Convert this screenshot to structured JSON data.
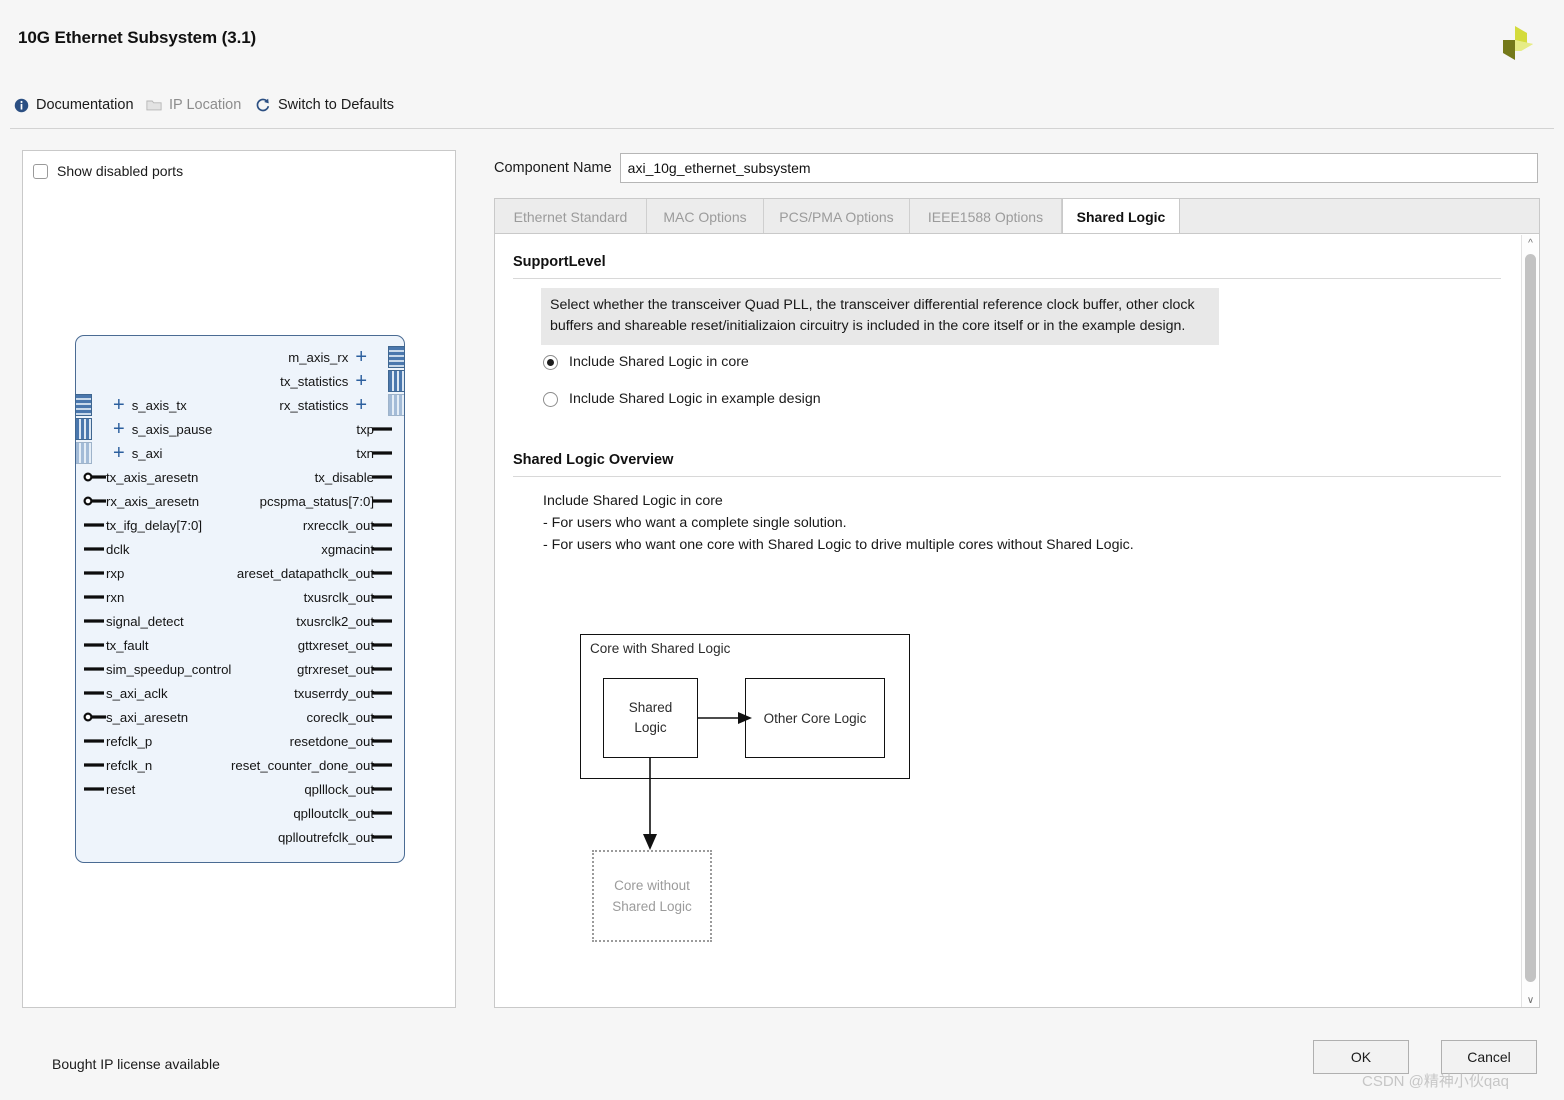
{
  "header": {
    "title": "10G Ethernet Subsystem (3.1)",
    "logo_icon": "xilinx-logo-icon",
    "logo_colors": {
      "dark": "#74791a",
      "mid": "#d4db3c",
      "light": "#e6ec86"
    }
  },
  "toolbar": {
    "documentation": "Documentation",
    "ip_location": "IP Location",
    "switch_defaults": "Switch to Defaults",
    "icons": {
      "documentation": "info-icon",
      "ip_location": "folder-icon",
      "switch_defaults": "refresh-icon"
    }
  },
  "left_panel": {
    "show_disabled_ports": "Show disabled ports",
    "checked": false,
    "ports_left": [
      {
        "name": "s_axis_tx",
        "kind": "bus"
      },
      {
        "name": "s_axis_pause",
        "kind": "bus"
      },
      {
        "name": "s_axi",
        "kind": "bus"
      },
      {
        "name": "tx_axis_aresetn",
        "kind": "pin-inv"
      },
      {
        "name": "rx_axis_aresetn",
        "kind": "pin-inv"
      },
      {
        "name": "tx_ifg_delay[7:0]",
        "kind": "pin"
      },
      {
        "name": "dclk",
        "kind": "pin"
      },
      {
        "name": "rxp",
        "kind": "pin"
      },
      {
        "name": "rxn",
        "kind": "pin"
      },
      {
        "name": "signal_detect",
        "kind": "pin"
      },
      {
        "name": "tx_fault",
        "kind": "pin"
      },
      {
        "name": "sim_speedup_control",
        "kind": "pin"
      },
      {
        "name": "s_axi_aclk",
        "kind": "pin"
      },
      {
        "name": "s_axi_aresetn",
        "kind": "pin-inv"
      },
      {
        "name": "refclk_p",
        "kind": "pin"
      },
      {
        "name": "refclk_n",
        "kind": "pin"
      },
      {
        "name": "reset",
        "kind": "pin"
      }
    ],
    "ports_right": [
      {
        "name": "m_axis_rx",
        "kind": "bus"
      },
      {
        "name": "tx_statistics",
        "kind": "bus"
      },
      {
        "name": "rx_statistics",
        "kind": "bus"
      },
      {
        "name": "txp",
        "kind": "pin"
      },
      {
        "name": "txn",
        "kind": "pin"
      },
      {
        "name": "tx_disable",
        "kind": "pin"
      },
      {
        "name": "pcspma_status[7:0]",
        "kind": "pin"
      },
      {
        "name": "rxrecclk_out",
        "kind": "pin"
      },
      {
        "name": "xgmacint",
        "kind": "pin"
      },
      {
        "name": "areset_datapathclk_out",
        "kind": "pin"
      },
      {
        "name": "txusrclk_out",
        "kind": "pin"
      },
      {
        "name": "txusrclk2_out",
        "kind": "pin"
      },
      {
        "name": "gttxreset_out",
        "kind": "pin"
      },
      {
        "name": "gtrxreset_out",
        "kind": "pin"
      },
      {
        "name": "txuserrdy_out",
        "kind": "pin"
      },
      {
        "name": "coreclk_out",
        "kind": "pin"
      },
      {
        "name": "resetdone_out",
        "kind": "pin"
      },
      {
        "name": "reset_counter_done_out",
        "kind": "pin"
      },
      {
        "name": "qplllock_out",
        "kind": "pin"
      },
      {
        "name": "qplloutclk_out",
        "kind": "pin"
      },
      {
        "name": "qplloutrefclk_out",
        "kind": "pin"
      }
    ]
  },
  "component": {
    "label": "Component Name",
    "value": "axi_10g_ethernet_subsystem"
  },
  "tabs": [
    {
      "label": "Ethernet Standard",
      "active": false
    },
    {
      "label": "MAC Options",
      "active": false
    },
    {
      "label": "PCS/PMA Options",
      "active": false
    },
    {
      "label": "IEEE1588 Options",
      "active": false
    },
    {
      "label": "Shared Logic",
      "active": true
    }
  ],
  "support_level": {
    "title": "SupportLevel",
    "help_line1": "Select whether the transceiver Quad PLL, the transceiver differential reference clock buffer, other clock",
    "help_line2": "buffers and shareable reset/initializaion circuitry is included in the core itself or in the example design.",
    "option_core": "Include Shared Logic in core",
    "option_example": "Include Shared Logic in example design",
    "selected": "core"
  },
  "overview": {
    "title": "Shared Logic Overview",
    "line1": "Include Shared Logic in core",
    "line2": "- For users who want a complete single solution.",
    "line3": "- For users who want one core with Shared Logic to drive multiple cores without Shared Logic."
  },
  "diagram": {
    "outer_label": "Core with Shared Logic",
    "shared_line1": "Shared",
    "shared_line2": "Logic",
    "other_label": "Other Core Logic",
    "dotted_line1": "Core without",
    "dotted_line2": "Shared Logic"
  },
  "footer": {
    "license": "Bought IP license available",
    "ok": "OK",
    "cancel": "Cancel",
    "watermark": "CSDN @精神小伙qaq"
  },
  "scrollbar": {
    "up_icon": "chevron-up-icon",
    "down_icon": "chevron-down-icon"
  }
}
